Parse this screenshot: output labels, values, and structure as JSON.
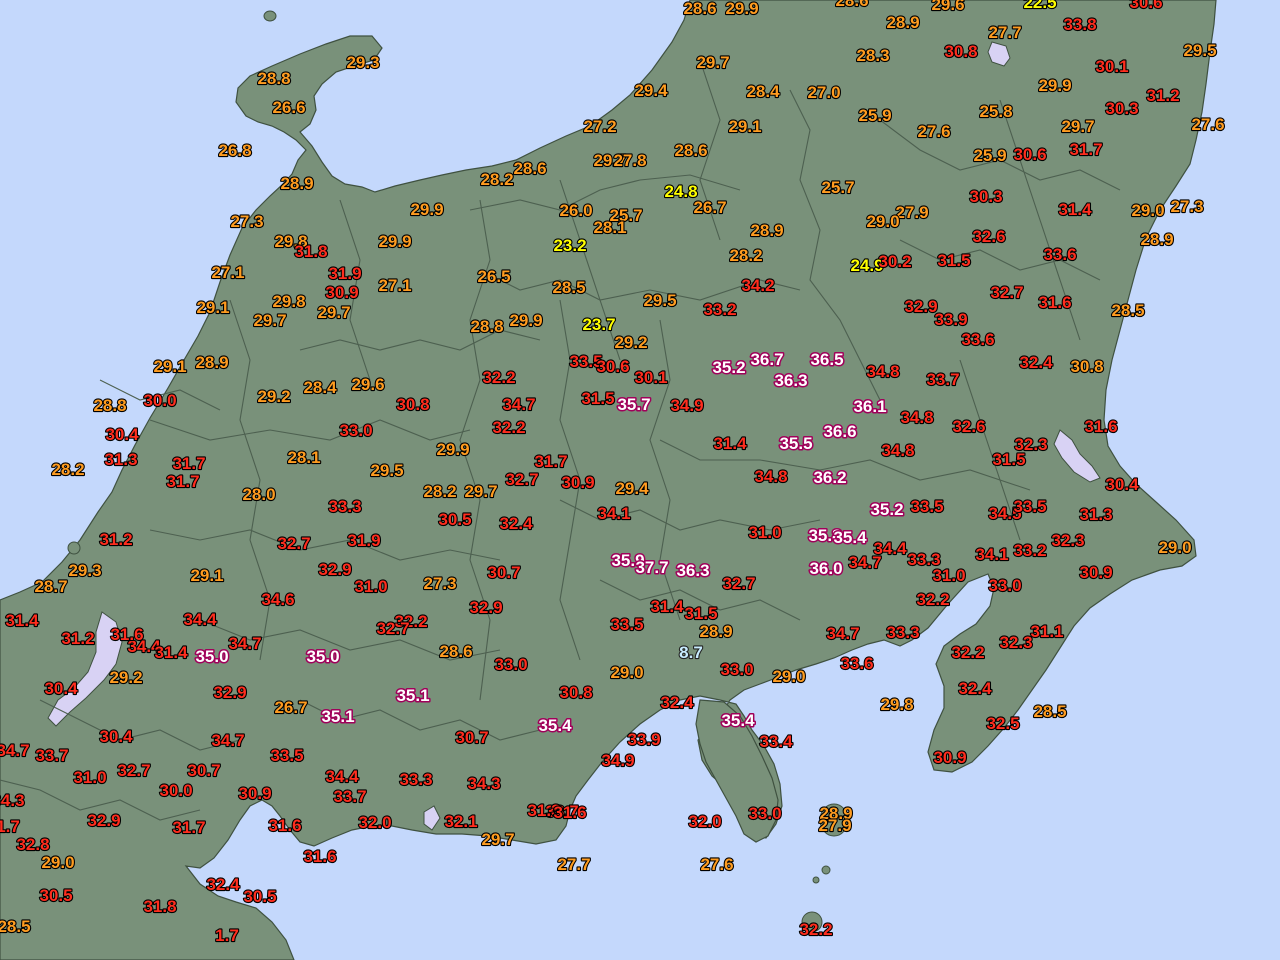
{
  "colors": {
    "sea": "#c4d8fc",
    "land": "#79917a",
    "border": "#4d6050",
    "lake": "#d8d2f4",
    "yellow": "#ffff00",
    "orange": "#ff9c20",
    "red": "#ff2d1e",
    "magenta": "#a0005a",
    "cyan": "#c8ecff"
  },
  "stations": [
    {
      "v": "28.6",
      "c": "orange"
    },
    {
      "v": "29.9",
      "c": "orange"
    },
    {
      "v": "28.6",
      "c": "orange"
    },
    {
      "v": "29.6",
      "c": "orange"
    },
    {
      "v": "22.5",
      "c": "yellow"
    },
    {
      "v": "30.6",
      "c": "red"
    },
    {
      "v": "28.9",
      "c": "orange"
    },
    {
      "v": "27.7",
      "c": "orange"
    },
    {
      "v": "33.8",
      "c": "red"
    },
    {
      "v": "29.3",
      "c": "orange"
    },
    {
      "v": "28.8",
      "c": "orange"
    },
    {
      "v": "29.7",
      "c": "orange"
    },
    {
      "v": "28.3",
      "c": "orange"
    },
    {
      "v": "30.8",
      "c": "red"
    },
    {
      "v": "29.5",
      "c": "orange"
    },
    {
      "v": "26.6",
      "c": "orange"
    },
    {
      "v": "30.1",
      "c": "red"
    },
    {
      "v": "29.4",
      "c": "orange"
    },
    {
      "v": "28.4",
      "c": "orange"
    },
    {
      "v": "27.0",
      "c": "orange"
    },
    {
      "v": "29.9",
      "c": "orange"
    },
    {
      "v": "31.2",
      "c": "red"
    },
    {
      "v": "30.3",
      "c": "red"
    },
    {
      "v": "25.9",
      "c": "orange"
    },
    {
      "v": "25.8",
      "c": "orange"
    },
    {
      "v": "27.2",
      "c": "orange"
    },
    {
      "v": "29.1",
      "c": "orange"
    },
    {
      "v": "27.6",
      "c": "orange"
    },
    {
      "v": "29.7",
      "c": "orange"
    },
    {
      "v": "27.6",
      "c": "orange"
    },
    {
      "v": "26.8",
      "c": "orange"
    },
    {
      "v": "28.6",
      "c": "orange"
    },
    {
      "v": "29.7",
      "c": "orange"
    },
    {
      "v": "27.8",
      "c": "orange"
    },
    {
      "v": "28.6",
      "c": "orange"
    },
    {
      "v": "31.7",
      "c": "red"
    },
    {
      "v": "25.9",
      "c": "orange"
    },
    {
      "v": "30.6",
      "c": "red"
    },
    {
      "v": "28.2",
      "c": "orange"
    },
    {
      "v": "28.9",
      "c": "orange"
    },
    {
      "v": "24.8",
      "c": "yellow"
    },
    {
      "v": "25.7",
      "c": "orange"
    },
    {
      "v": "30.3",
      "c": "red"
    },
    {
      "v": "29.9",
      "c": "orange"
    },
    {
      "v": "26.0",
      "c": "orange"
    },
    {
      "v": "25.7",
      "c": "orange"
    },
    {
      "v": "26.7",
      "c": "orange"
    },
    {
      "v": "27.9",
      "c": "orange"
    },
    {
      "v": "31.4",
      "c": "red"
    },
    {
      "v": "29.0",
      "c": "orange"
    },
    {
      "v": "27.3",
      "c": "orange"
    },
    {
      "v": "27.3",
      "c": "orange"
    },
    {
      "v": "28.1",
      "c": "orange"
    },
    {
      "v": "28.9",
      "c": "orange"
    },
    {
      "v": "29.0",
      "c": "orange"
    },
    {
      "v": "32.6",
      "c": "red"
    },
    {
      "v": "29.8",
      "c": "orange"
    },
    {
      "v": "29.9",
      "c": "orange"
    },
    {
      "v": "23.2",
      "c": "yellow"
    },
    {
      "v": "28.9",
      "c": "orange"
    },
    {
      "v": "31.8",
      "c": "red"
    },
    {
      "v": "28.2",
      "c": "orange"
    },
    {
      "v": "33.6",
      "c": "red"
    },
    {
      "v": "24.9",
      "c": "yellow"
    },
    {
      "v": "30.2",
      "c": "red"
    },
    {
      "v": "31.5",
      "c": "red"
    },
    {
      "v": "27.1",
      "c": "orange"
    },
    {
      "v": "31.9",
      "c": "red"
    },
    {
      "v": "26.5",
      "c": "orange"
    },
    {
      "v": "30.9",
      "c": "red"
    },
    {
      "v": "27.1",
      "c": "orange"
    },
    {
      "v": "28.5",
      "c": "orange"
    },
    {
      "v": "34.2",
      "c": "red"
    },
    {
      "v": "32.7",
      "c": "red"
    },
    {
      "v": "29.8",
      "c": "orange"
    },
    {
      "v": "29.1",
      "c": "orange"
    },
    {
      "v": "29.5",
      "c": "orange"
    },
    {
      "v": "31.6",
      "c": "red"
    },
    {
      "v": "33.2",
      "c": "red"
    },
    {
      "v": "32.9",
      "c": "red"
    },
    {
      "v": "28.5",
      "c": "orange"
    },
    {
      "v": "29.7",
      "c": "orange"
    },
    {
      "v": "29.7",
      "c": "orange"
    },
    {
      "v": "28.8",
      "c": "orange"
    },
    {
      "v": "29.9",
      "c": "orange"
    },
    {
      "v": "23.7",
      "c": "yellow"
    },
    {
      "v": "33.9",
      "c": "red"
    },
    {
      "v": "33.6",
      "c": "red"
    },
    {
      "v": "29.2",
      "c": "orange"
    },
    {
      "v": "29.1",
      "c": "orange"
    },
    {
      "v": "28.9",
      "c": "orange"
    },
    {
      "v": "33.5",
      "c": "red"
    },
    {
      "v": "30.6",
      "c": "red"
    },
    {
      "v": "35.2",
      "c": "magenta"
    },
    {
      "v": "36.7",
      "c": "magenta"
    },
    {
      "v": "36.5",
      "c": "magenta"
    },
    {
      "v": "32.4",
      "c": "red"
    },
    {
      "v": "30.8",
      "c": "orange"
    },
    {
      "v": "34.8",
      "c": "red"
    },
    {
      "v": "36.3",
      "c": "magenta"
    },
    {
      "v": "30.1",
      "c": "red"
    },
    {
      "v": "33.7",
      "c": "red"
    },
    {
      "v": "32.2",
      "c": "red"
    },
    {
      "v": "29.2",
      "c": "orange"
    },
    {
      "v": "28.4",
      "c": "orange"
    },
    {
      "v": "29.6",
      "c": "orange"
    },
    {
      "v": "28.8",
      "c": "orange"
    },
    {
      "v": "30.0",
      "c": "red"
    },
    {
      "v": "30.8",
      "c": "red"
    },
    {
      "v": "34.7",
      "c": "red"
    },
    {
      "v": "31.5",
      "c": "red"
    },
    {
      "v": "35.7",
      "c": "magenta"
    },
    {
      "v": "34.9",
      "c": "red"
    },
    {
      "v": "36.1",
      "c": "magenta"
    },
    {
      "v": "34.8",
      "c": "red"
    },
    {
      "v": "30.4",
      "c": "red"
    },
    {
      "v": "33.0",
      "c": "red"
    },
    {
      "v": "32.2",
      "c": "red"
    },
    {
      "v": "31.4",
      "c": "red"
    },
    {
      "v": "35.5",
      "c": "magenta"
    },
    {
      "v": "36.6",
      "c": "magenta"
    },
    {
      "v": "32.6",
      "c": "red"
    },
    {
      "v": "31.6",
      "c": "red"
    },
    {
      "v": "31.3",
      "c": "red"
    },
    {
      "v": "28.2",
      "c": "orange"
    },
    {
      "v": "28.1",
      "c": "orange"
    },
    {
      "v": "29.9",
      "c": "orange"
    },
    {
      "v": "34.8",
      "c": "red"
    },
    {
      "v": "32.3",
      "c": "red"
    },
    {
      "v": "31.7",
      "c": "red"
    },
    {
      "v": "31.5",
      "c": "red"
    },
    {
      "v": "29.5",
      "c": "orange"
    },
    {
      "v": "31.7",
      "c": "red"
    },
    {
      "v": "31.7",
      "c": "red"
    },
    {
      "v": "32.7",
      "c": "red"
    },
    {
      "v": "30.9",
      "c": "red"
    },
    {
      "v": "34.8",
      "c": "red"
    },
    {
      "v": "36.2",
      "c": "magenta"
    },
    {
      "v": "30.4",
      "c": "red"
    },
    {
      "v": "28.0",
      "c": "orange"
    },
    {
      "v": "28.2",
      "c": "orange"
    },
    {
      "v": "29.7",
      "c": "orange"
    },
    {
      "v": "33.3",
      "c": "red"
    },
    {
      "v": "29.4",
      "c": "orange"
    },
    {
      "v": "35.2",
      "c": "magenta"
    },
    {
      "v": "33.5",
      "c": "red"
    },
    {
      "v": "34.5",
      "c": "red"
    },
    {
      "v": "33.5",
      "c": "red"
    },
    {
      "v": "31.3",
      "c": "red"
    },
    {
      "v": "30.5",
      "c": "red"
    },
    {
      "v": "32.4",
      "c": "red"
    },
    {
      "v": "34.1",
      "c": "red"
    },
    {
      "v": "31.0",
      "c": "red"
    },
    {
      "v": "35.8",
      "c": "magenta"
    },
    {
      "v": "35.4",
      "c": "magenta"
    },
    {
      "v": "31.2",
      "c": "red"
    },
    {
      "v": "32.7",
      "c": "red"
    },
    {
      "v": "31.9",
      "c": "red"
    },
    {
      "v": "34.4",
      "c": "red"
    },
    {
      "v": "34.1",
      "c": "red"
    },
    {
      "v": "33.2",
      "c": "red"
    },
    {
      "v": "32.3",
      "c": "red"
    },
    {
      "v": "29.0",
      "c": "orange"
    },
    {
      "v": "35.9",
      "c": "magenta"
    },
    {
      "v": "34.7",
      "c": "red"
    },
    {
      "v": "33.3",
      "c": "red"
    },
    {
      "v": "29.3",
      "c": "orange"
    },
    {
      "v": "29.1",
      "c": "orange"
    },
    {
      "v": "32.9",
      "c": "red"
    },
    {
      "v": "30.7",
      "c": "red"
    },
    {
      "v": "37.7",
      "c": "magenta"
    },
    {
      "v": "36.3",
      "c": "magenta"
    },
    {
      "v": "36.0",
      "c": "magenta"
    },
    {
      "v": "31.0",
      "c": "red"
    },
    {
      "v": "30.9",
      "c": "red"
    },
    {
      "v": "28.7",
      "c": "orange"
    },
    {
      "v": "31.0",
      "c": "red"
    },
    {
      "v": "27.3",
      "c": "orange"
    },
    {
      "v": "32.7",
      "c": "red"
    },
    {
      "v": "33.0",
      "c": "red"
    },
    {
      "v": "34.6",
      "c": "red"
    },
    {
      "v": "32.2",
      "c": "red"
    },
    {
      "v": "31.4",
      "c": "red"
    },
    {
      "v": "34.4",
      "c": "red"
    },
    {
      "v": "32.9",
      "c": "red"
    },
    {
      "v": "31.4",
      "c": "red"
    },
    {
      "v": "31.5",
      "c": "red"
    },
    {
      "v": "32.2",
      "c": "red"
    },
    {
      "v": "33.5",
      "c": "red"
    },
    {
      "v": "32.7",
      "c": "red"
    },
    {
      "v": "34.4",
      "c": "red"
    },
    {
      "v": "28.9",
      "c": "orange"
    },
    {
      "v": "34.7",
      "c": "red"
    },
    {
      "v": "33.3",
      "c": "red"
    },
    {
      "v": "31.1",
      "c": "red"
    },
    {
      "v": "31.2",
      "c": "red"
    },
    {
      "v": "31.6",
      "c": "red"
    },
    {
      "v": "34.7",
      "c": "red"
    },
    {
      "v": "31.4",
      "c": "red"
    },
    {
      "v": "32.3",
      "c": "red"
    },
    {
      "v": "35.0",
      "c": "magenta"
    },
    {
      "v": "35.0",
      "c": "magenta"
    },
    {
      "v": "28.6",
      "c": "orange"
    },
    {
      "v": "33.0",
      "c": "red"
    },
    {
      "v": "8.7",
      "c": "cyan"
    },
    {
      "v": "32.2",
      "c": "red"
    },
    {
      "v": "33.6",
      "c": "red"
    },
    {
      "v": "29.2",
      "c": "orange"
    },
    {
      "v": "30.4",
      "c": "red"
    },
    {
      "v": "29.0",
      "c": "orange"
    },
    {
      "v": "33.0",
      "c": "red"
    },
    {
      "v": "29.0",
      "c": "orange"
    },
    {
      "v": "32.4",
      "c": "red"
    },
    {
      "v": "32.9",
      "c": "red"
    },
    {
      "v": "35.1",
      "c": "magenta"
    },
    {
      "v": "30.8",
      "c": "red"
    },
    {
      "v": "32.4",
      "c": "red"
    },
    {
      "v": "29.8",
      "c": "orange"
    },
    {
      "v": "28.5",
      "c": "orange"
    },
    {
      "v": "26.7",
      "c": "orange"
    },
    {
      "v": "35.1",
      "c": "magenta"
    },
    {
      "v": "35.4",
      "c": "magenta"
    },
    {
      "v": "35.4",
      "c": "magenta"
    },
    {
      "v": "32.5",
      "c": "red"
    },
    {
      "v": "30.4",
      "c": "red"
    },
    {
      "v": "34.7",
      "c": "red"
    },
    {
      "v": "33.5",
      "c": "red"
    },
    {
      "v": "30.7",
      "c": "red"
    },
    {
      "v": "33.9",
      "c": "red"
    },
    {
      "v": "33.4",
      "c": "red"
    },
    {
      "v": "34.3",
      "c": "red"
    },
    {
      "v": "33.7",
      "c": "red"
    },
    {
      "v": "34.7",
      "c": "red"
    },
    {
      "v": "32.7",
      "c": "red"
    },
    {
      "v": "30.7",
      "c": "red"
    },
    {
      "v": "34.9",
      "c": "red"
    },
    {
      "v": "30.9",
      "c": "red"
    },
    {
      "v": "31.0",
      "c": "red"
    },
    {
      "v": "34.4",
      "c": "red"
    },
    {
      "v": "33.3",
      "c": "red"
    },
    {
      "v": "34.3",
      "c": "red"
    },
    {
      "v": "30.9",
      "c": "red"
    },
    {
      "v": "30.0",
      "c": "red"
    },
    {
      "v": "33.7",
      "c": "red"
    },
    {
      "v": "33.7",
      "c": "red"
    },
    {
      "v": "31.3",
      "c": "red"
    },
    {
      "v": "31.6",
      "c": "red"
    },
    {
      "v": "28.9",
      "c": "orange"
    },
    {
      "v": "32.9",
      "c": "red"
    },
    {
      "v": "31.7",
      "c": "red"
    },
    {
      "v": "31.6",
      "c": "red"
    },
    {
      "v": "32.0",
      "c": "red"
    },
    {
      "v": "32.1",
      "c": "red"
    },
    {
      "v": "32.0",
      "c": "red"
    },
    {
      "v": "33.0",
      "c": "red"
    },
    {
      "v": "27.9",
      "c": "orange"
    },
    {
      "v": "32.8",
      "c": "red"
    },
    {
      "v": "1.7",
      "c": "red"
    },
    {
      "v": "29.7",
      "c": "orange"
    },
    {
      "v": "31.6",
      "c": "red"
    },
    {
      "v": "29.0",
      "c": "orange"
    },
    {
      "v": "27.7",
      "c": "orange"
    },
    {
      "v": "27.6",
      "c": "orange"
    },
    {
      "v": "32.4",
      "c": "red"
    },
    {
      "v": "30.5",
      "c": "red"
    },
    {
      "v": "31.8",
      "c": "red"
    },
    {
      "v": "32.2",
      "c": "red"
    },
    {
      "v": "28.5",
      "c": "orange"
    },
    {
      "v": "1.7",
      "c": "red"
    },
    {
      "v": "30.5",
      "c": "red"
    }
  ]
}
